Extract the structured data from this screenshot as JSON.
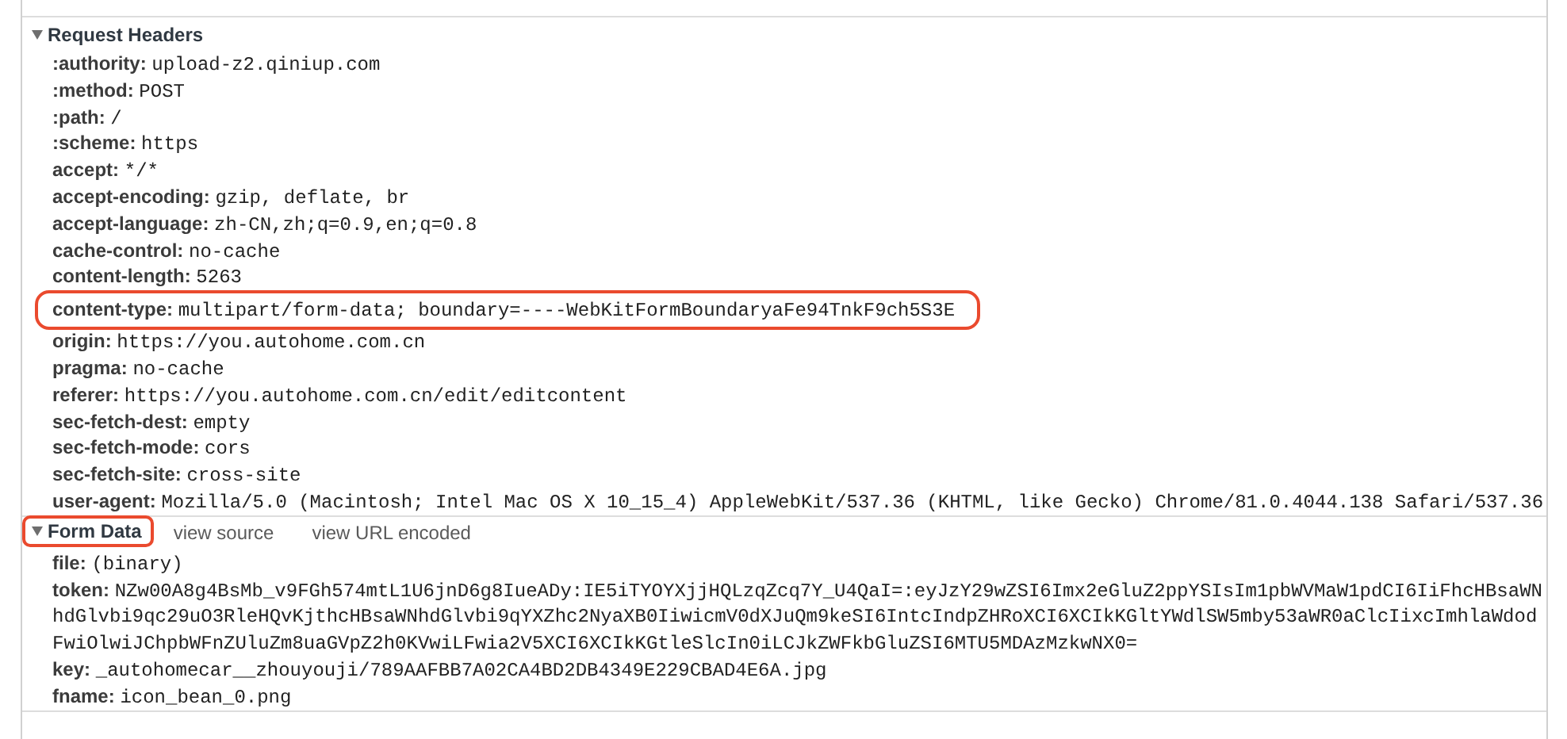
{
  "sections": [
    {
      "title": "Request Headers",
      "expanded": true,
      "highlighted": false,
      "rows": [
        {
          "key": ":authority:",
          "value": "upload-z2.qiniup.com",
          "highlighted": false
        },
        {
          "key": ":method:",
          "value": "POST",
          "highlighted": false
        },
        {
          "key": ":path:",
          "value": "/",
          "highlighted": false
        },
        {
          "key": ":scheme:",
          "value": "https",
          "highlighted": false
        },
        {
          "key": "accept:",
          "value": "*/*",
          "highlighted": false
        },
        {
          "key": "accept-encoding:",
          "value": "gzip, deflate, br",
          "highlighted": false
        },
        {
          "key": "accept-language:",
          "value": "zh-CN,zh;q=0.9,en;q=0.8",
          "highlighted": false
        },
        {
          "key": "cache-control:",
          "value": "no-cache",
          "highlighted": false
        },
        {
          "key": "content-length:",
          "value": "5263",
          "highlighted": false
        },
        {
          "key": "content-type:",
          "value": "multipart/form-data; boundary=----WebKitFormBoundaryaFe94TnkF9ch5S3E",
          "highlighted": true
        },
        {
          "key": "origin:",
          "value": "https://you.autohome.com.cn",
          "highlighted": false
        },
        {
          "key": "pragma:",
          "value": "no-cache",
          "highlighted": false
        },
        {
          "key": "referer:",
          "value": "https://you.autohome.com.cn/edit/editcontent",
          "highlighted": false
        },
        {
          "key": "sec-fetch-dest:",
          "value": "empty",
          "highlighted": false
        },
        {
          "key": "sec-fetch-mode:",
          "value": "cors",
          "highlighted": false
        },
        {
          "key": "sec-fetch-site:",
          "value": "cross-site",
          "highlighted": false
        },
        {
          "key": "user-agent:",
          "value": "Mozilla/5.0 (Macintosh; Intel Mac OS X 10_15_4) AppleWebKit/537.36 (KHTML, like Gecko) Chrome/81.0.4044.138 Safari/537.36",
          "highlighted": false
        }
      ]
    },
    {
      "title": "Form Data",
      "expanded": true,
      "highlighted": true,
      "links": [
        "view source",
        "view URL encoded"
      ],
      "rows": [
        {
          "key": "file:",
          "value": "(binary)",
          "highlighted": false
        },
        {
          "key": "token:",
          "value": "NZw00A8g4BsMb_v9FGh574mtL1U6jnD6g8IueADy:IE5iTYOYXjjHQLzqZcq7Y_U4QaI=:eyJzY29wZSI6Imx2eGluZ2ppYSIsIm1pbWVMaW1pdCI6IiFhcHBsaWNhdGlvbi9qc29uO3RleHQvKjthcHBsaWNhdGlvbi9qYXZhc2NyaXB0IiwicmV0dXJuQm9keSI6IntcIndpZHRoXCI6XCIkKGltYWdlSW5mby53aWR0aClcIixcImhlaWdodFwiOlwiJChpbWFnZUluZm8uaGVpZ2h0KVwiLFwia2V5XCI6XCIkKGtleSlcIn0iLCJkZWFkbGluZSI6MTU5MDAzMzkwNX0=",
          "highlighted": false
        },
        {
          "key": "key:",
          "value": "_autohomecar__zhouyouji/789AAFBB7A02CA4BD2DB4349E229CBAD4E6A.jpg",
          "highlighted": false
        },
        {
          "key": "fname:",
          "value": "icon_bean_0.png",
          "highlighted": false
        }
      ]
    }
  ]
}
